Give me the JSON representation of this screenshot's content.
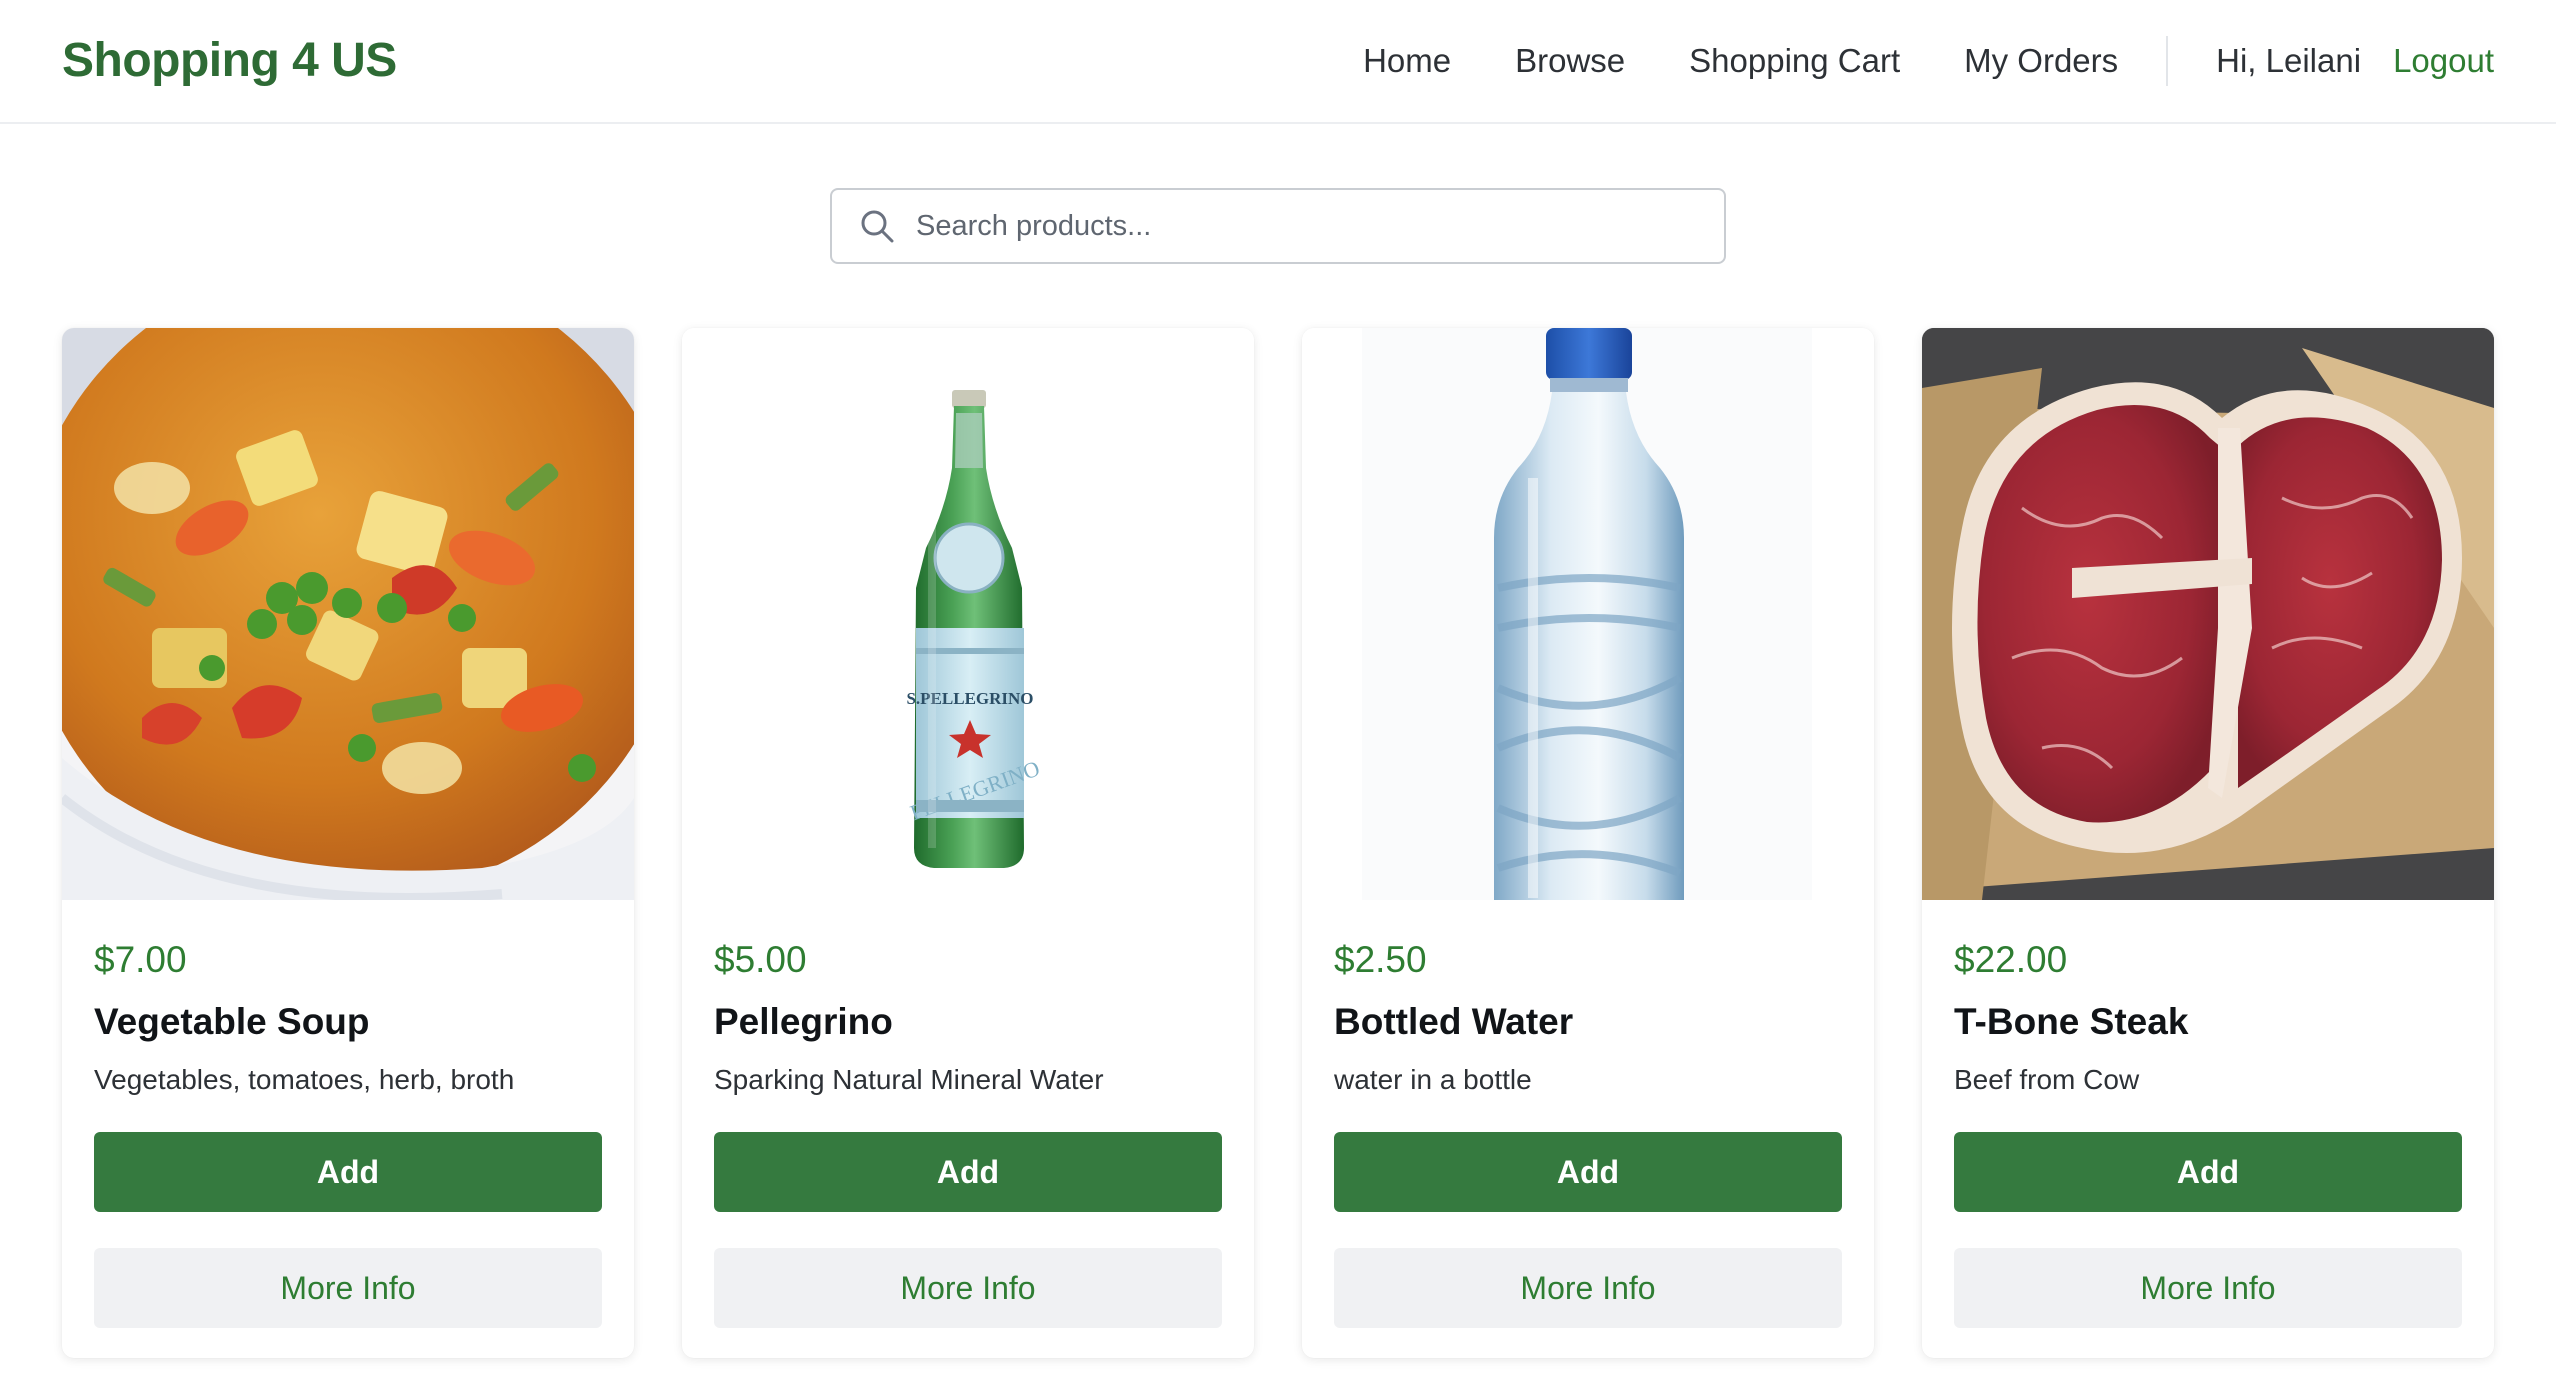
{
  "brand": {
    "name": "Shopping 4 US",
    "color": "#2e6b35"
  },
  "nav": {
    "links": [
      "Home",
      "Browse",
      "Shopping Cart",
      "My Orders"
    ],
    "greeting": "Hi, Leilani",
    "logout": "Logout"
  },
  "search": {
    "placeholder": "Search products...",
    "value": "",
    "icon": "search-icon"
  },
  "accent_colors": {
    "primary_button": "#357a3f",
    "price": "#2e7d32",
    "secondary_button_bg": "#f0f1f3"
  },
  "products": [
    {
      "price": "$7.00",
      "name": "Vegetable Soup",
      "description": "Vegetables, tomatoes, herb, broth",
      "image": "vegetable-soup-image",
      "add_label": "Add",
      "info_label": "More Info"
    },
    {
      "price": "$5.00",
      "name": "Pellegrino",
      "description": "Sparking Natural Mineral Water",
      "image": "pellegrino-bottle-image",
      "add_label": "Add",
      "info_label": "More Info"
    },
    {
      "price": "$2.50",
      "name": "Bottled Water",
      "description": "water in a bottle",
      "image": "water-bottle-image",
      "add_label": "Add",
      "info_label": "More Info"
    },
    {
      "price": "$22.00",
      "name": "T-Bone Steak",
      "description": "Beef from Cow",
      "image": "t-bone-steak-image",
      "add_label": "Add",
      "info_label": "More Info"
    }
  ]
}
